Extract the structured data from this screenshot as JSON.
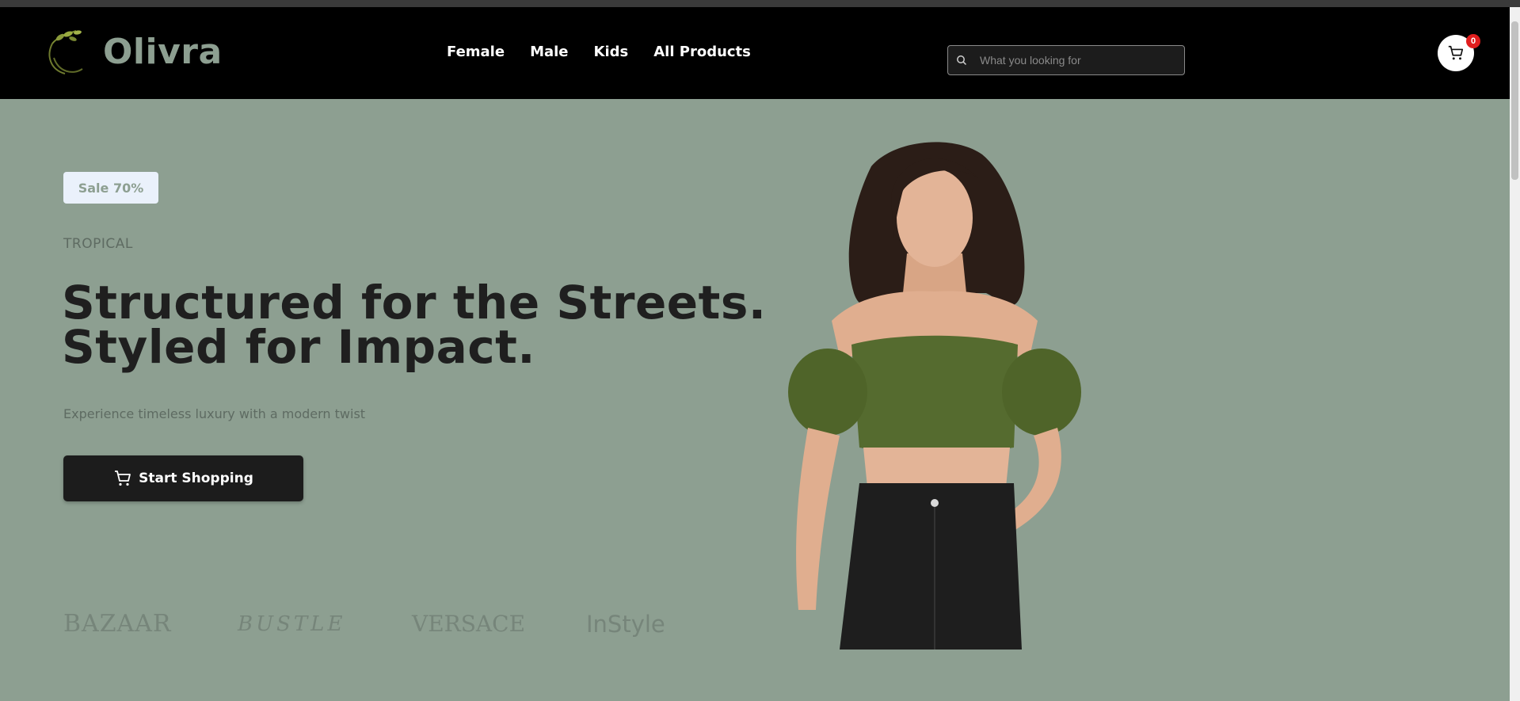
{
  "brand": {
    "name": "Olivra"
  },
  "nav": {
    "links": [
      "Female",
      "Male",
      "Kids",
      "All Products"
    ]
  },
  "search": {
    "placeholder": "What you looking for"
  },
  "cart": {
    "count": "0"
  },
  "hero": {
    "badge": "Sale 70%",
    "eyebrow": "TROPICAL",
    "headline_line1": "Structured for the Streets.",
    "headline_line2": "Styled for Impact.",
    "subtext": "Experience timeless luxury with a modern twist",
    "cta_label": "Start Shopping"
  },
  "press_logos": [
    "BAZAAR",
    "BUSTLE",
    "VERSACE",
    "InStyle"
  ],
  "colors": {
    "background": "#8d9f91",
    "navbar": "#000000",
    "logo_text": "#8d9f91",
    "badge_bg": "#eaf1fb",
    "cta_bg": "#1c1c1c",
    "cart_badge": "#e11d1d",
    "top_green": "#556b2f",
    "jeans": "#1e1e1e"
  },
  "icons": {
    "logo": "olive-branch-icon",
    "search": "search-icon",
    "cart": "cart-icon"
  }
}
